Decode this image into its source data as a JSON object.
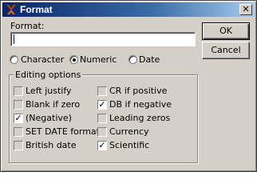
{
  "window": {
    "title": "Format"
  },
  "format_field": {
    "label": "Format:",
    "value": ""
  },
  "buttons": {
    "ok": "OK",
    "cancel": "Cancel"
  },
  "type_options": [
    {
      "label": "Character",
      "selected": false
    },
    {
      "label": "Numeric",
      "selected": true
    },
    {
      "label": "Date",
      "selected": false
    }
  ],
  "editing_options": {
    "title": "Editing options",
    "left": [
      {
        "label": "Left justify",
        "checked": false
      },
      {
        "label": "Blank if zero",
        "checked": false
      },
      {
        "label": "(Negative)",
        "checked": true
      },
      {
        "label": "SET DATE format",
        "checked": false
      },
      {
        "label": "British date",
        "checked": false
      }
    ],
    "right": [
      {
        "label": "CR if positive",
        "checked": false
      },
      {
        "label": "DB if negative",
        "checked": true
      },
      {
        "label": "Leading zeros",
        "checked": false
      },
      {
        "label": "Currency",
        "checked": false
      },
      {
        "label": "Scientific",
        "checked": true
      }
    ]
  }
}
